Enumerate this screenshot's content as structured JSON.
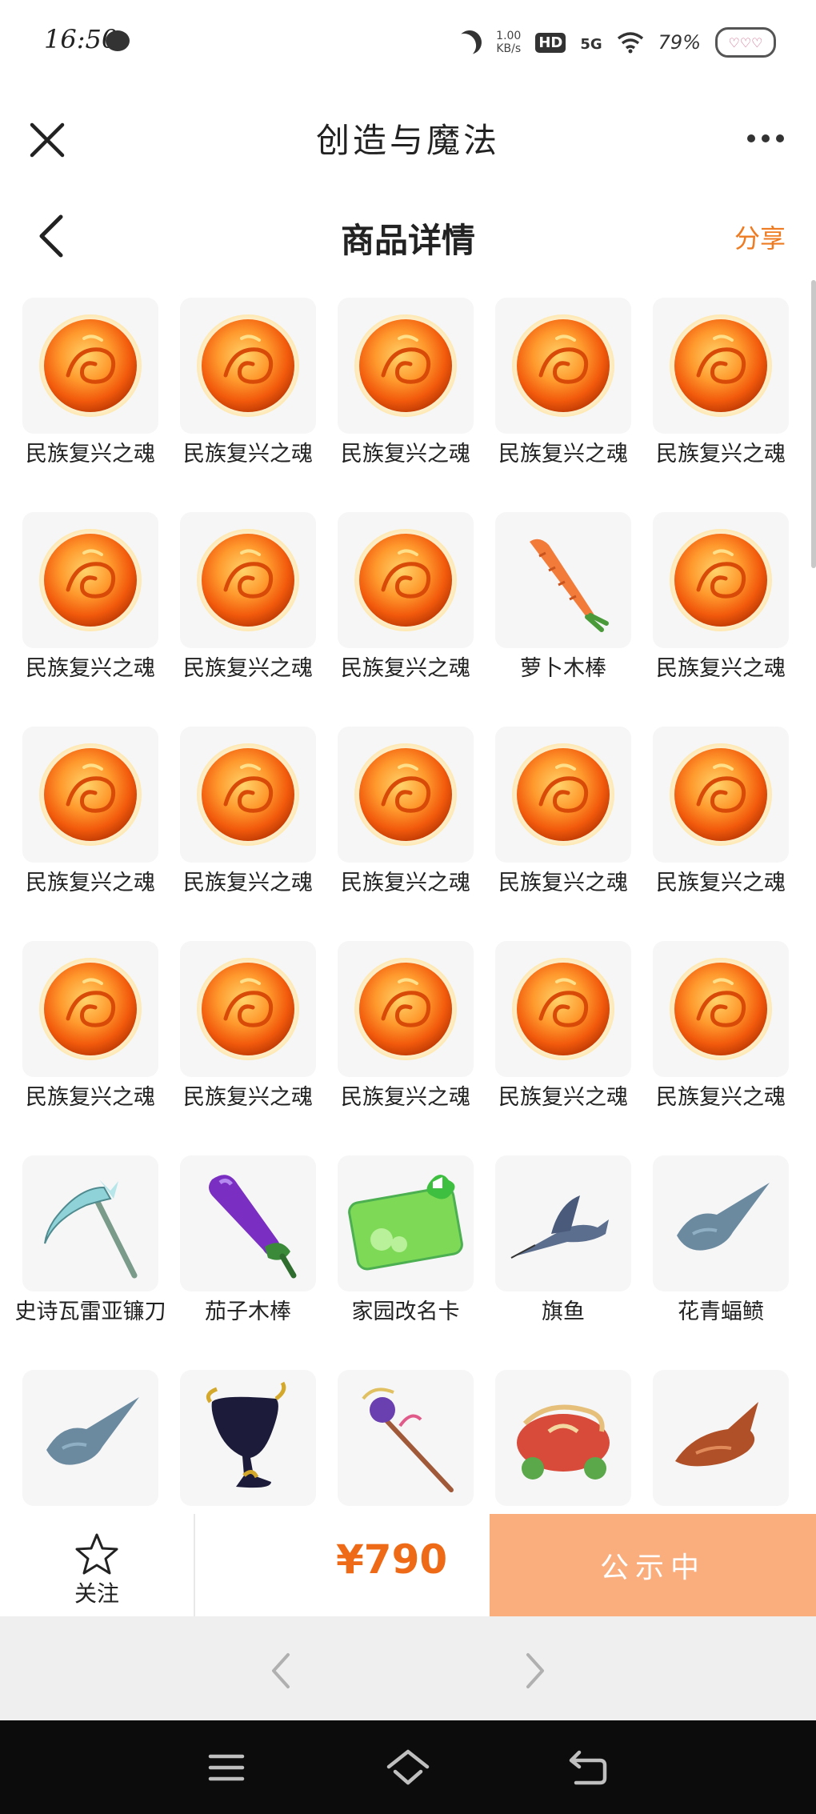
{
  "status_bar": {
    "time": "16:50",
    "net_speed_value": "1.00",
    "net_speed_unit": "KB/s",
    "hd_label": "HD",
    "network": "5G",
    "battery": "79%",
    "icons": [
      "chat-bubble-icon",
      "moon-icon",
      "hd-icon",
      "signal-icon",
      "wifi-icon",
      "battery-icon"
    ]
  },
  "app_bar": {
    "title": "创造与魔法",
    "close_icon": "close-icon",
    "more_icon": "more-icon"
  },
  "page_header": {
    "title": "商品详情",
    "share_label": "分享",
    "back_icon": "chevron-left-icon"
  },
  "items": [
    {
      "name": "民族复兴之魂",
      "icon": "orb"
    },
    {
      "name": "民族复兴之魂",
      "icon": "orb"
    },
    {
      "name": "民族复兴之魂",
      "icon": "orb"
    },
    {
      "name": "民族复兴之魂",
      "icon": "orb"
    },
    {
      "name": "民族复兴之魂",
      "icon": "orb"
    },
    {
      "name": "民族复兴之魂",
      "icon": "orb"
    },
    {
      "name": "民族复兴之魂",
      "icon": "orb"
    },
    {
      "name": "民族复兴之魂",
      "icon": "orb"
    },
    {
      "name": "萝卜木棒",
      "icon": "carrot"
    },
    {
      "name": "民族复兴之魂",
      "icon": "orb"
    },
    {
      "name": "民族复兴之魂",
      "icon": "orb"
    },
    {
      "name": "民族复兴之魂",
      "icon": "orb"
    },
    {
      "name": "民族复兴之魂",
      "icon": "orb"
    },
    {
      "name": "民族复兴之魂",
      "icon": "orb"
    },
    {
      "name": "民族复兴之魂",
      "icon": "orb"
    },
    {
      "name": "民族复兴之魂",
      "icon": "orb"
    },
    {
      "name": "民族复兴之魂",
      "icon": "orb"
    },
    {
      "name": "民族复兴之魂",
      "icon": "orb"
    },
    {
      "name": "民族复兴之魂",
      "icon": "orb"
    },
    {
      "name": "民族复兴之魂",
      "icon": "orb"
    },
    {
      "name": "史诗瓦雷亚镰刀",
      "icon": "scythe"
    },
    {
      "name": "茄子木棒",
      "icon": "eggplant"
    },
    {
      "name": "家园改名卡",
      "icon": "rename-card"
    },
    {
      "name": "旗鱼",
      "icon": "swordfish"
    },
    {
      "name": "花青蝠鲼",
      "icon": "manta-ray"
    },
    {
      "name": "",
      "icon": "manta-ray"
    },
    {
      "name": "",
      "icon": "goblet"
    },
    {
      "name": "",
      "icon": "staff"
    },
    {
      "name": "",
      "icon": "dragon-cart"
    },
    {
      "name": "",
      "icon": "fish"
    }
  ],
  "action_bar": {
    "follow_label": "关注",
    "price": "¥790",
    "status_label": "公示中",
    "colors": {
      "price": "#ef6a16",
      "status_bg": "#faae7e",
      "accent": "#ee7b22"
    }
  },
  "browser_nav": {
    "prev_icon": "chevron-left-icon",
    "next_icon": "chevron-right-icon"
  },
  "system_nav": {
    "icons": [
      "menu-icon",
      "home-icon",
      "back-icon"
    ]
  }
}
